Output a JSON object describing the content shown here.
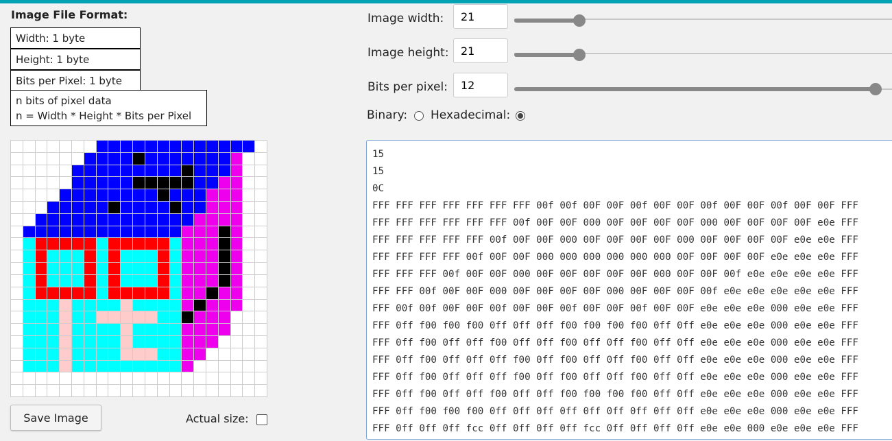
{
  "format": {
    "title": "Image File Format:",
    "width_line": "Width: 1 byte",
    "height_line": "Height: 1 byte",
    "bpp_line": "Bits per Pixel: 1 byte",
    "data_line1": "n bits of pixel data",
    "data_line2": "n = Width * Height * Bits per Pixel"
  },
  "controls": {
    "width_label": "Image width:",
    "width_value": "21",
    "width_slider_fraction": 0.19,
    "height_label": "Image height:",
    "height_value": "21",
    "height_slider_fraction": 0.19,
    "bpp_label": "Bits per pixel:",
    "bpp_value": "12",
    "bpp_slider_fraction": 1.0,
    "binary_label": "Binary:",
    "hex_label": "Hexadecimal:",
    "selected_mode": "hexadecimal"
  },
  "buttons": {
    "save": "Save Image",
    "actual_size": "Actual size:"
  },
  "colors": {
    "accent": "#00a3b4",
    "W": "#ffffff",
    "B": "#0000ff",
    "K": "#000000",
    "M": "#ee00ee",
    "R": "#ff0000",
    "C": "#00ffff",
    "P": "#ffcccc"
  },
  "pixels": [
    "WWWWWWWBBBBBBBBBBBBBW",
    "WWWWWWBBBBKBBBBBBBMWW",
    "WWWWWBBBBBBBBBKBBBMWW",
    "WWWWWBBBBBKKKKKBBMMWW",
    "WWWWBBBBBBBBKBBBMMMWW",
    "WWWBBBBBKBBBBKBBMMMWW",
    "WWBBBBBBBBBBBBBMMMMWW",
    "WBBBBBBBBBBBBBMMMKMWW",
    "WCRRRRRCRRRRRCMMMKMWW",
    "WCRCCCRCRCCCRCMMMKMWW",
    "WCRCCCRCRCCCRCMMMKMWW",
    "WCRCCCRCRCCCRCMMMKMWW",
    "WCRRRRRCRRRRRCMMKMMWW",
    "WCCCPCCCCPCCCCMKMMMWW",
    "WCCCPCCPPPPPCCKMMMWWW",
    "WCCCPCCCCPCCCCMMMMWWW",
    "WCCCPCCCCPCCCCMMMWWWW",
    "WCCCPCCCCPPPCCMMWWWWW",
    "WCCCPCCCCCCCCCMWWWWWW",
    "WWWWWWWWWWWWWWWWWWWWW",
    "WWWWWWWWWWWWWWWWWWWWW"
  ],
  "hex_lines": [
    "15",
    "15",
    "0C",
    "FFF FFF FFF FFF FFF FFF FFF 00f 00f 00F 00F 00f 00F 00F 00f 00F 00F 00f 00F 00F FFF",
    "FFF FFF FFF FFF FFF FFF 00f 00F 00F 000 00F 00F 00F 00F 000 00F 00F 00F 00F e0e FFF",
    "FFF FFF FFF FFF FFF 00f 00F 00F 000 00F 00F 00F 00F 000 00F 00F 00F 00F e0e e0e FFF",
    "FFF FFF FFF FFF 00f 00F 00F 000 000 000 000 000 000 00F 00F 00F 00F e0e e0e e0e FFF",
    "FFF FFF FFF 00f 00F 00F 000 00F 00F 00F 00F 00F 000 00F 00F 00f e0e e0e e0e e0e FFF",
    "FFF FFF 00f 00F 00F 000 00F 00F 00F 00F 000 00F 00F 00F 00f e0e e0e e0e e0e e0e FFF",
    "FFF 00f 00f 00F 00F 00f 00F 00F 00f 00F 00F 00f 00F 00F e0e e0e e0e 000 e0e e0e FFF",
    "FFF 0ff f00 f00 f00 0ff 0ff 0ff f00 f00 f00 f00 0ff 0ff e0e e0e e0e 000 e0e e0e FFF",
    "FFF 0ff f00 0ff 0ff f00 0ff 0ff f00 0ff 0ff f00 0ff 0ff e0e e0e e0e 000 e0e e0e FFF",
    "FFF 0ff f00 0ff 0ff 0ff f00 0ff f00 0ff 0ff f00 0ff 0ff e0e e0e e0e 000 e0e e0e FFF",
    "FFF 0ff f00 0ff 0ff 0ff f00 0ff f00 0ff 0ff f00 0ff 0ff e0e e0e e0e 000 e0e e0e FFF",
    "FFF 0ff f00 0ff 0ff f00 0ff 0ff f00 f00 f00 f00 0ff 0ff e0e e0e e0e 000 e0e e0e FFF",
    "FFF 0ff f00 f00 f00 0ff 0ff 0ff 0ff 0ff 0ff 0ff 0ff 0ff e0e e0e e0e 000 e0e e0e FFF",
    "FFF 0ff 0ff 0ff fcc 0ff 0ff 0ff 0ff fcc 0ff 0ff 0ff 0ff e0e e0e 000 e0e e0e e0e FFF"
  ]
}
